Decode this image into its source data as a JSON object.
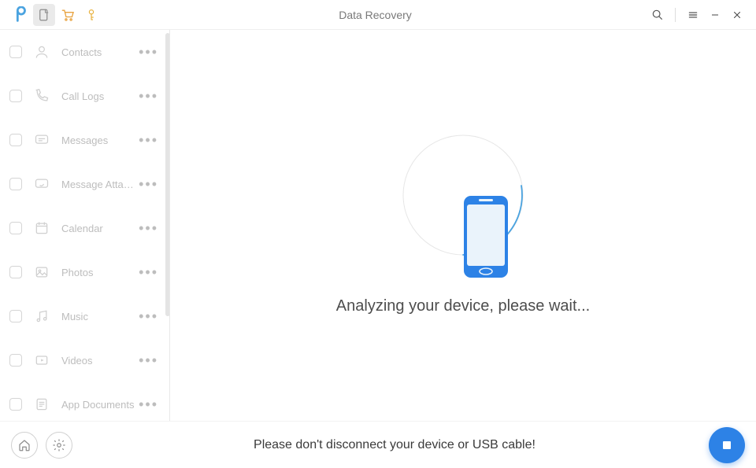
{
  "app": {
    "title": "Data Recovery"
  },
  "sidebar": {
    "items": [
      {
        "id": "contacts",
        "label": "Contacts",
        "icon": "person-icon"
      },
      {
        "id": "call-logs",
        "label": "Call Logs",
        "icon": "phone-icon"
      },
      {
        "id": "messages",
        "label": "Messages",
        "icon": "chat-icon"
      },
      {
        "id": "msg-attach",
        "label": "Message Attach...",
        "icon": "attachment-icon"
      },
      {
        "id": "calendar",
        "label": "Calendar",
        "icon": "calendar-icon"
      },
      {
        "id": "photos",
        "label": "Photos",
        "icon": "image-icon"
      },
      {
        "id": "music",
        "label": "Music",
        "icon": "music-icon"
      },
      {
        "id": "videos",
        "label": "Videos",
        "icon": "video-icon"
      },
      {
        "id": "app-docs",
        "label": "App Documents",
        "icon": "document-icon"
      }
    ]
  },
  "content": {
    "status": "Analyzing your device, please wait..."
  },
  "footer": {
    "warning": "Please don't disconnect your device or USB cable!"
  }
}
